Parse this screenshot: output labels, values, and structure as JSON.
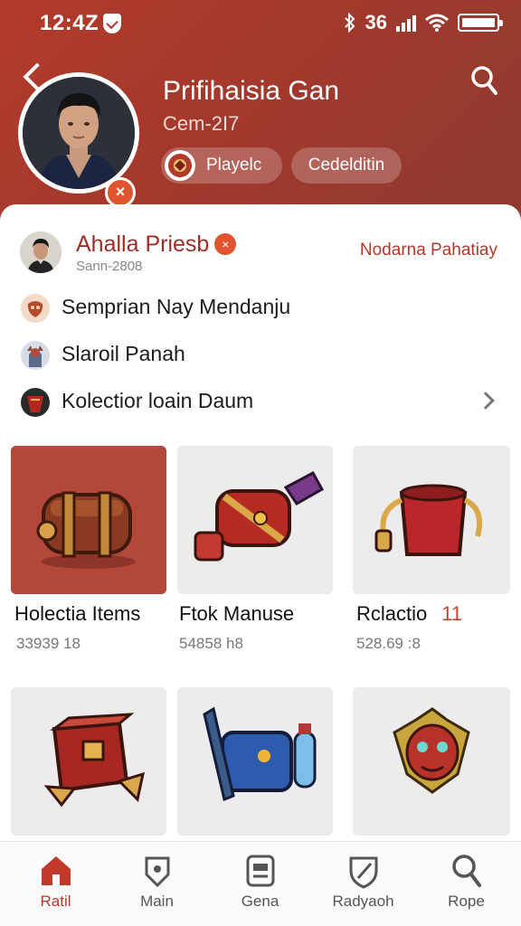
{
  "status_bar": {
    "time": "12:4Z",
    "network": "36",
    "batt_icon": "battery-icon",
    "wifi_icon": "wifi-icon"
  },
  "header": {
    "back_icon": "chevron-left-icon",
    "search_icon": "search-icon",
    "name": "Prifihaisia Gan",
    "subtitle": "Cem-2I7",
    "badge_icon": "close-icon",
    "pills": [
      {
        "label": "Playelc",
        "icon": "player-icon"
      },
      {
        "label": "Cedelditin"
      }
    ]
  },
  "user": {
    "name": "Ahalla Priesb",
    "badge_icon": "verified-icon",
    "subtitle": "Sann-2808",
    "link": "Nodarna Pahatiay"
  },
  "menu": [
    {
      "label": "Semprian Nay Mendanju",
      "icon": "mask-icon"
    },
    {
      "label": "Slaroil Panah",
      "icon": "warrior-icon"
    },
    {
      "label": "Kolectior loain Daum",
      "icon": "collection-icon",
      "chevron": "chevron-right-icon"
    }
  ],
  "items": [
    {
      "name": "Holectia Items",
      "count": "33939 18",
      "icon": "chest-icon"
    },
    {
      "name": "Ftok Manuse",
      "count": "54858 h8",
      "icon": "hammer-chest-icon"
    },
    {
      "name": "Rclactio",
      "badge": "11",
      "count": "528.69 :8",
      "icon": "bucket-icon"
    },
    {
      "name": "",
      "count": "",
      "icon": "box-icon"
    },
    {
      "name": "",
      "count": "",
      "icon": "backpack-potion-icon"
    },
    {
      "name": "",
      "count": "",
      "icon": "dragon-icon"
    }
  ],
  "nav": [
    {
      "label": "Ratil",
      "icon": "home-icon",
      "active": true
    },
    {
      "label": "Main",
      "icon": "location-icon"
    },
    {
      "label": "Gena",
      "icon": "card-icon"
    },
    {
      "label": "Radyaoh",
      "icon": "shield-icon"
    },
    {
      "label": "Rope",
      "icon": "search-icon"
    }
  ],
  "colors": {
    "header": "#a2392c",
    "accent": "#b23a2b",
    "badge": "#e0552f"
  }
}
